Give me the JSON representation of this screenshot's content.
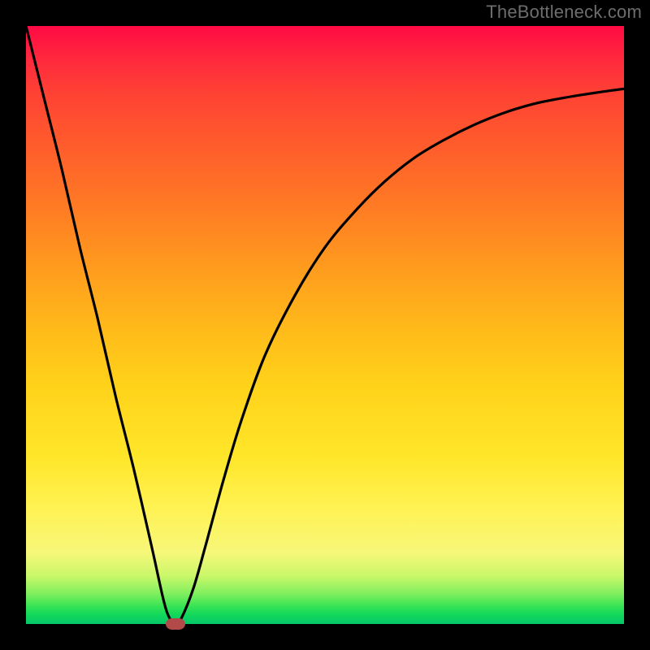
{
  "watermark": "TheBottleneck.com",
  "colors": {
    "frame": "#000000",
    "gradient_top": "#ff0a44",
    "gradient_bottom": "#05c76a",
    "curve": "#000000",
    "marker": "#b24a4a"
  },
  "chart_data": {
    "type": "line",
    "title": "",
    "xlabel": "",
    "ylabel": "",
    "xlim": [
      0,
      100
    ],
    "ylim": [
      0,
      100
    ],
    "grid": false,
    "legend": false,
    "series": [
      {
        "name": "bottleneck-curve",
        "x": [
          0,
          3,
          6,
          9,
          12,
          15,
          18,
          21,
          23,
          24,
          25,
          26,
          28,
          30,
          33,
          36,
          40,
          45,
          50,
          55,
          60,
          65,
          70,
          75,
          80,
          85,
          90,
          95,
          100
        ],
        "y": [
          100,
          88,
          76,
          63,
          51,
          38,
          26,
          13,
          4,
          1,
          0,
          1,
          6,
          13,
          24,
          34,
          45,
          55,
          63,
          69,
          74,
          78,
          81,
          83.5,
          85.5,
          87,
          88,
          88.8,
          89.5
        ]
      }
    ],
    "marker": {
      "x": 25,
      "y": 0
    },
    "notes": "No axes, ticks, or labels are shown in the image; values are proportional (0–100) estimated from pixel positions. Left branch is near-linear descent; right branch is a decelerating rise approaching an asymptote near y≈90."
  }
}
